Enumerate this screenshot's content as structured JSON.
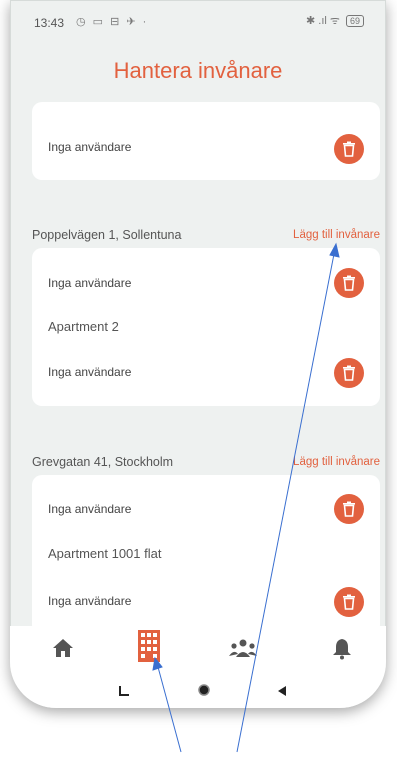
{
  "status": {
    "time": "13:43",
    "icons_left": "◷ ▭ ⊟ ✈ ·",
    "icons_right": "✱ .ıl ᯤ",
    "battery": "69"
  },
  "header": {
    "title": "Hantera invånare"
  },
  "colors": {
    "accent": "#e2613f",
    "background": "#eef1f0"
  },
  "top_card": {
    "row_text": "Inga användare"
  },
  "sections": [
    {
      "address": "Poppelvägen 1, Sollentuna",
      "add_label": "Lägg till invånare",
      "rows": [
        {
          "text": "Inga användare"
        },
        {
          "apartment": "Apartment 2"
        },
        {
          "text": "Inga användare"
        }
      ]
    },
    {
      "address": "Grevgatan 41, Stockholm",
      "add_label": "Lägg till invånare",
      "rows": [
        {
          "text": "Inga användare"
        },
        {
          "apartment": "Apartment 1001 flat"
        },
        {
          "text": "Inga användare"
        }
      ]
    }
  ],
  "bottom_nav": {
    "items": [
      {
        "icon": "home-icon"
      },
      {
        "icon": "building-icon",
        "active": true
      },
      {
        "icon": "people-icon"
      },
      {
        "icon": "bell-icon"
      }
    ]
  },
  "system_nav": {
    "icons": [
      "recents-icon",
      "home-circle-icon",
      "back-icon"
    ]
  }
}
